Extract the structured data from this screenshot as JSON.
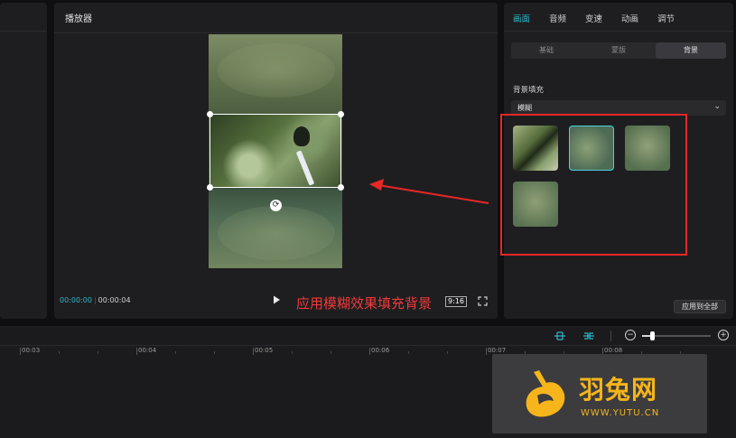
{
  "player": {
    "title": "播放器",
    "current_time": "00:00:00",
    "total_time": "00:00:04",
    "aspect_ratio": "9:16"
  },
  "annotation": {
    "text": "应用模糊效果填充背景",
    "color": "#f0393a"
  },
  "right_panel": {
    "tabs": [
      {
        "label": "画面",
        "active": true
      },
      {
        "label": "音频",
        "active": false
      },
      {
        "label": "变速",
        "active": false
      },
      {
        "label": "动画",
        "active": false
      },
      {
        "label": "调节",
        "active": false
      }
    ],
    "subtabs": [
      {
        "label": "基础",
        "active": false
      },
      {
        "label": "蒙版",
        "active": false
      },
      {
        "label": "背景",
        "active": true
      }
    ],
    "fill_label": "背景填充",
    "fill_mode": "模糊",
    "blur_swatches": 4,
    "selected_swatch_index": 1,
    "apply_all_label": "应用到全部"
  },
  "timeline": {
    "ruler_labels": [
      "00:03",
      "00:04",
      "00:05",
      "00:06",
      "00:07",
      "00:08"
    ]
  },
  "watermark": {
    "brand_name": "羽兔网",
    "brand_url": "WWW.YUTU.CN",
    "color": "#f5b51b"
  },
  "accent_color": "#2fb5c9"
}
